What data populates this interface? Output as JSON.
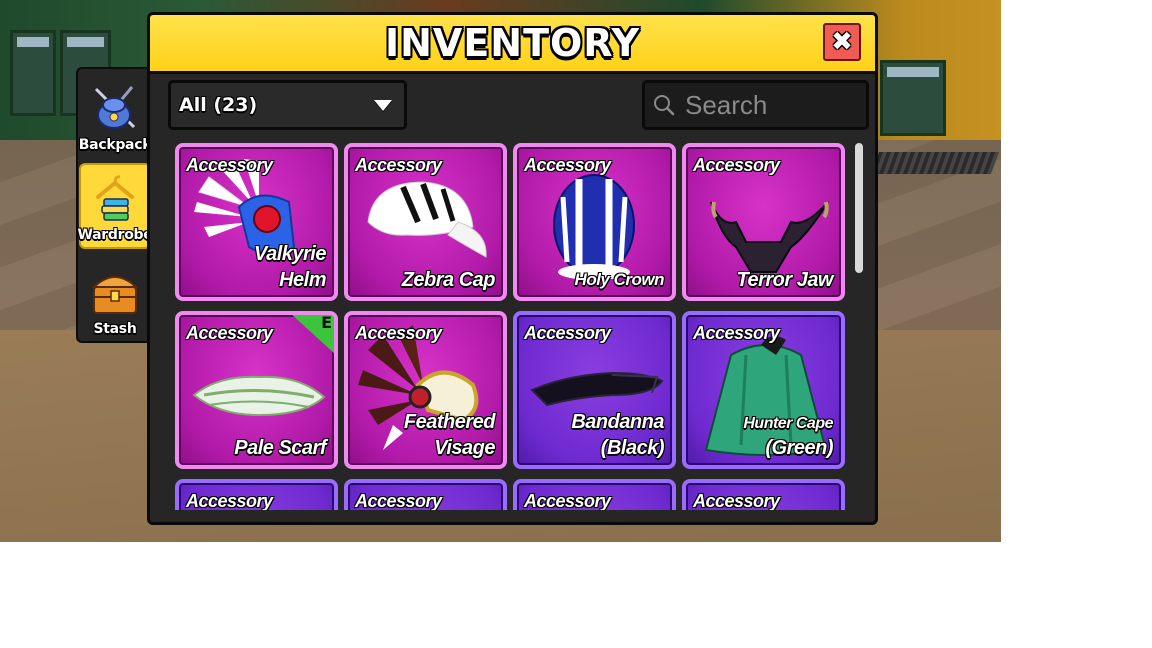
{
  "sidebar": {
    "items": [
      {
        "label": "Backpack",
        "icon": "backpack-icon",
        "active": false
      },
      {
        "label": "Wardrobe",
        "icon": "hanger-icon",
        "active": true
      },
      {
        "label": "Stash",
        "icon": "chest-icon",
        "active": false
      }
    ]
  },
  "window": {
    "title": "INVENTORY",
    "close_icon": "close-icon"
  },
  "filter": {
    "selected": "All (23)"
  },
  "search": {
    "placeholder": "Search"
  },
  "items": [
    {
      "type": "Accessory",
      "name": "Valkyrie Helm",
      "rarity": "pink",
      "equipped": false
    },
    {
      "type": "Accessory",
      "name": "Zebra Cap",
      "rarity": "pink",
      "equipped": false
    },
    {
      "type": "Accessory",
      "name": "Holy Crown",
      "rarity": "pink",
      "equipped": false
    },
    {
      "type": "Accessory",
      "name": "Terror Jaw",
      "rarity": "pink",
      "equipped": false
    },
    {
      "type": "Accessory",
      "name": "Pale Scarf",
      "rarity": "pink",
      "equipped": true,
      "equipped_badge": "E"
    },
    {
      "type": "Accessory",
      "name": "Feathered Visage",
      "rarity": "pink",
      "equipped": false
    },
    {
      "type": "Accessory",
      "name": "Bandanna (Black)",
      "rarity": "purple",
      "equipped": false
    },
    {
      "type": "Accessory",
      "name_line1": "Hunter Cape",
      "name_line2": "(Green)",
      "rarity": "purple",
      "equipped": false
    },
    {
      "type": "Accessory",
      "name": "",
      "rarity": "purple",
      "equipped": false
    },
    {
      "type": "Accessory",
      "name": "",
      "rarity": "purple",
      "equipped": false
    },
    {
      "type": "Accessory",
      "name": "",
      "rarity": "purple",
      "equipped": false
    },
    {
      "type": "Accessory",
      "name": "",
      "rarity": "purple",
      "equipped": false
    }
  ],
  "colors": {
    "title_bar": "#ffd21a",
    "panel": "#262626",
    "card_pink": "#b11aa8",
    "card_purple": "#6e2ad0",
    "close_button": "#f15b56",
    "equipped_badge": "#3bc43c"
  }
}
